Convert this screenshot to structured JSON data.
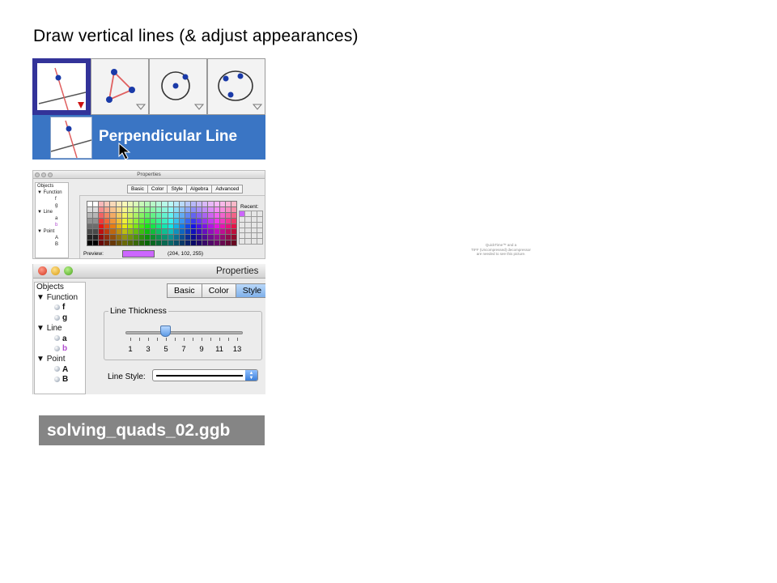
{
  "slide": {
    "title": "Draw vertical lines (& adjust appearances)"
  },
  "toolbar": {
    "buttons": [
      {
        "name": "perpendicular-line-tool",
        "icon": "perpendicular-line-icon",
        "selected": true
      },
      {
        "name": "polygon-tool",
        "icon": "polygon-icon",
        "selected": false
      },
      {
        "name": "circle-center-point-tool",
        "icon": "circle-center-point-icon",
        "selected": false
      },
      {
        "name": "circle-three-points-tool",
        "icon": "circle-three-points-icon",
        "selected": false
      }
    ],
    "menu_item_label": "Perpendicular Line",
    "accent_color": "#333399",
    "menu_highlight_color": "#3a75c4"
  },
  "properties_color": {
    "window_title": "Properties",
    "tree": [
      "Objects",
      "▼ Function",
      "f",
      "g",
      "▼ Line",
      "a",
      "b",
      "▼ Point",
      "A",
      "B"
    ],
    "tabs": [
      "Basic",
      "Color",
      "Style",
      "Algebra",
      "Advanced"
    ],
    "recent_label": "Recent:",
    "preview_label": "Preview:",
    "preview_value": "(204, 102, 255)",
    "preview_color": "#cc66ff"
  },
  "properties_style": {
    "window_title": "Properties",
    "tree": {
      "header": "Objects",
      "groups": [
        {
          "label": "Function",
          "items": [
            "f",
            "g"
          ]
        },
        {
          "label": "Line",
          "items": [
            "a",
            "b"
          ]
        },
        {
          "label": "Point",
          "items": [
            "A",
            "B"
          ]
        }
      ]
    },
    "tabs": [
      "Basic",
      "Color",
      "Style"
    ],
    "active_tab": "Style",
    "line_thickness_label": "Line Thickness",
    "line_thickness_value": 5,
    "tick_labels": [
      "1",
      "3",
      "5",
      "7",
      "9",
      "11",
      "13"
    ],
    "line_style_label": "Line Style:"
  },
  "file_badge": "solving_quads_02.ggb",
  "quicktime_notice": [
    "QuickTime™ and a",
    "TIFF (Uncompressed) decompressor",
    "are needed to see this picture."
  ]
}
